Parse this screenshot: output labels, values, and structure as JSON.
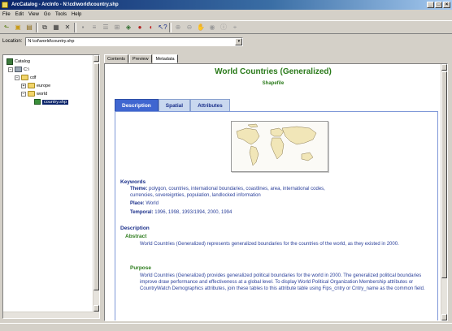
{
  "window": {
    "title": "ArcCatalog - ArcInfo - N:\\cd\\world\\country.shp"
  },
  "menu": [
    "File",
    "Edit",
    "View",
    "Go",
    "Tools",
    "Help"
  ],
  "toolbar_icons": [
    "up-one-level-icon",
    "connect-folder-icon",
    "disconnect-folder-icon",
    "copy-icon",
    "paste-icon",
    "delete-icon",
    "large-icons-icon",
    "list-icon",
    "details-icon",
    "thumbnails-icon",
    "launch-arcmap-icon",
    "arctoolbox-icon",
    "metadata-icon",
    "whats-this-icon",
    "select-icon",
    "zoom-in-icon",
    "zoom-out-icon",
    "pan-icon",
    "full-extent-icon",
    "identify-icon",
    "create-thumbnail-icon"
  ],
  "location": {
    "label": "Location:",
    "value": "N:\\cd\\world\\country.shp"
  },
  "tree": {
    "items": [
      {
        "label": "Catalog"
      },
      {
        "label": "C:\\"
      },
      {
        "label": "cdf"
      },
      {
        "label": "europe"
      },
      {
        "label": "world"
      },
      {
        "label": "country.shp"
      }
    ]
  },
  "view_tabs": [
    "Contents",
    "Preview",
    "Metadata"
  ],
  "metadata": {
    "title": "World Countries (Generalized)",
    "subtitle": "Shapefile",
    "tabs": [
      "Description",
      "Spatial",
      "Attributes"
    ],
    "keywords_heading": "Keywords",
    "theme_label": "Theme:",
    "theme_value": "polygon, countries, international boundaries, coastlines, area, international codes,",
    "theme_value_2": "currencies, sovereignties, population, landlocked information",
    "place_label": "Place:",
    "place_value": "World",
    "temporal_label": "Temporal:",
    "temporal_value": "1996, 1998, 1993/1994, 2000, 1994",
    "description_heading": "Description",
    "abstract_heading": "Abstract",
    "abstract_text": "World Countries (Generalized) represents generalized boundaries for the countries of the world, as they existed in 2000.",
    "purpose_heading": "Purpose",
    "purpose_text": "World Countries (Generalized) provides generalized political boundaries for the world in 2000. The generalized political boundaries improve draw performance and effectiveness at a global level. To display World Political Organization Membership attributes or CountryWatch Demographics attributes, join these tables to this attribute table using Fips_cntry or Cntry_name as the common field."
  }
}
